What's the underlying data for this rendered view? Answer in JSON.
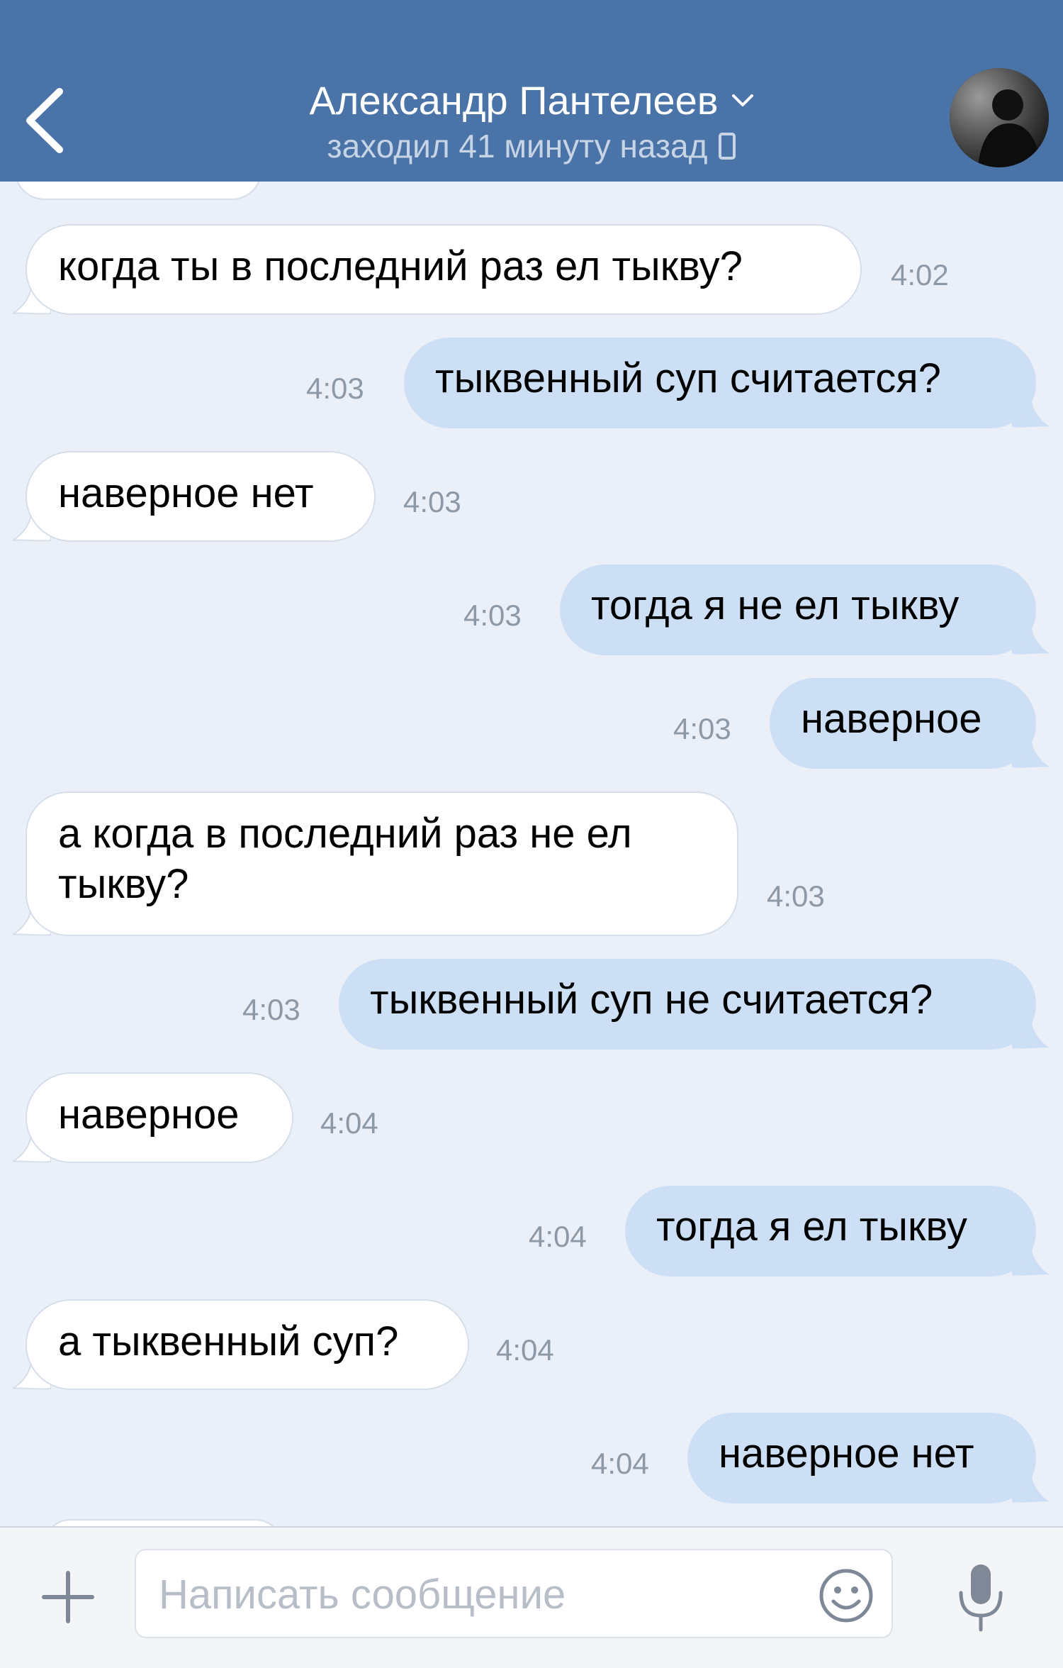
{
  "header": {
    "contact_name": "Александр Пантелеев",
    "status": "заходил 41 минуту назад"
  },
  "messages": [
    {
      "dir": "in",
      "text": "когда ты в последний раз ел тыкву?",
      "time": "4:02"
    },
    {
      "dir": "out",
      "text": "тыквенный суп считается?",
      "time": "4:03"
    },
    {
      "dir": "in",
      "text": "наверное нет",
      "time": "4:03"
    },
    {
      "dir": "out",
      "text": "тогда я не ел тыкву",
      "time": "4:03"
    },
    {
      "dir": "out",
      "text": "наверное",
      "time": "4:03"
    },
    {
      "dir": "in",
      "text": "а когда в последний раз не ел",
      "text2": "тыкву?",
      "time": "4:03"
    },
    {
      "dir": "out",
      "text": "тыквенный суп не считается?",
      "time": "4:03"
    },
    {
      "dir": "in",
      "text": "наверное",
      "time": "4:04"
    },
    {
      "dir": "out",
      "text": "тогда я ел тыкву",
      "time": "4:04"
    },
    {
      "dir": "in",
      "text": "а тыквенный суп?",
      "time": "4:04"
    },
    {
      "dir": "out",
      "text": "наверное нет",
      "time": "4:04"
    }
  ],
  "composer": {
    "placeholder": "Написать сообщение"
  },
  "colors": {
    "header_bg": "#4a73a8",
    "chat_bg": "#ebf0f8",
    "incoming_bubble": "#ffffff",
    "outgoing_bubble": "#cddff5"
  },
  "icons": [
    "back-arrow-icon",
    "chevron-down-icon",
    "phone-icon",
    "plus-icon",
    "emoji-icon",
    "microphone-icon"
  ]
}
